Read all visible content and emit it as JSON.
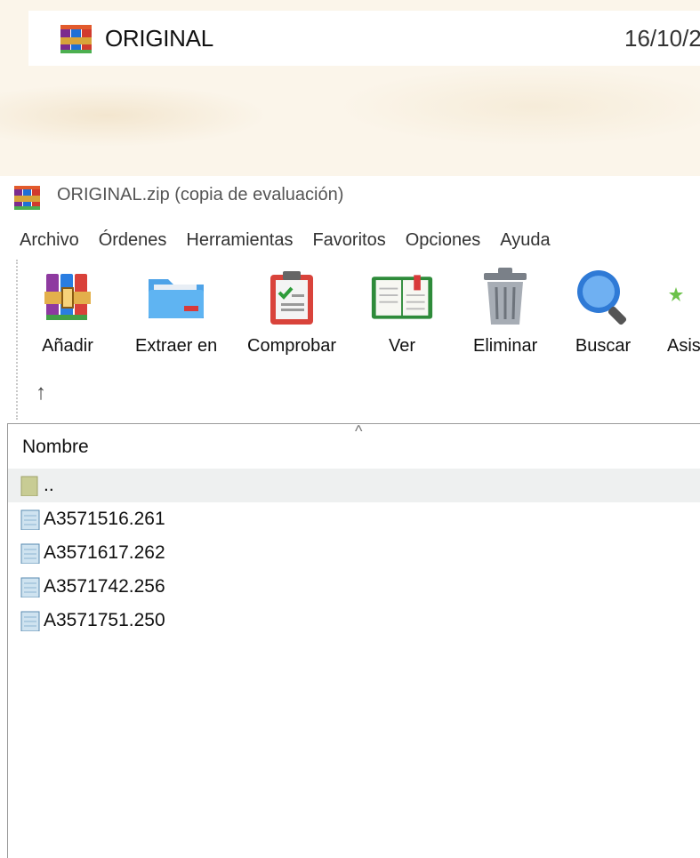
{
  "desktop_row": {
    "name": "ORIGINAL",
    "date": "16/10/2"
  },
  "window": {
    "title": "ORIGINAL.zip (copia de evaluación)"
  },
  "menu": [
    "Archivo",
    "Órdenes",
    "Herramientas",
    "Favoritos",
    "Opciones",
    "Ayuda"
  ],
  "toolbar": {
    "buttons": [
      {
        "label": "Añadir",
        "icon": "books-add-icon"
      },
      {
        "label": "Extraer en",
        "icon": "folder-extract-icon"
      },
      {
        "label": "Comprobar",
        "icon": "clipboard-check-icon"
      },
      {
        "label": "Ver",
        "icon": "book-view-icon"
      },
      {
        "label": "Eliminar",
        "icon": "trash-icon"
      },
      {
        "label": "Buscar",
        "icon": "magnifier-icon"
      },
      {
        "label": "Asis",
        "icon": "wizard-icon"
      }
    ],
    "up_arrow": "↑"
  },
  "list": {
    "column_header": "Nombre",
    "sort_glyph": "^",
    "parent": "..",
    "files": [
      "A3571516.261",
      "A3571617.262",
      "A3571742.256",
      "A3571751.250"
    ]
  }
}
